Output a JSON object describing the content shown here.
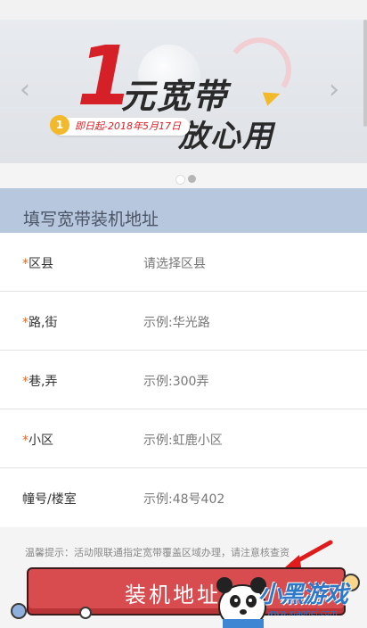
{
  "banner": {
    "big_number": "1",
    "title_line1": "元宽带",
    "title_line2": "放心用",
    "coin_text": "1",
    "date_text": "即日起-2018年5月17日",
    "prev_arrow": "‹",
    "next_arrow": "›"
  },
  "carousel": {
    "slide_count": 2,
    "active_index": 1
  },
  "section": {
    "title": "填写宽带装机地址"
  },
  "form": {
    "rows": [
      {
        "label": "区县",
        "required": "*",
        "value": "请选择区县"
      },
      {
        "label": "路,街",
        "required": "*",
        "value": "示例:华光路"
      },
      {
        "label": "巷,弄",
        "required": "*",
        "value": "示例:300弄"
      },
      {
        "label": "小区",
        "required": "*",
        "value": "示例:虹鹿小区"
      },
      {
        "label": "幢号/楼室",
        "required": "",
        "value": "示例:48号402"
      }
    ]
  },
  "tip": {
    "text": "温馨提示：活动限联通指定宽带覆盖区域办理，请注意核查资"
  },
  "submit": {
    "label": "装机地址"
  },
  "watermark": {
    "text": "小黑游戏",
    "url": "www.xiaohei.com"
  },
  "colors": {
    "accent_red": "#d84b4f",
    "section_blue": "#b7c7dd",
    "required_orange": "#e26a2b",
    "brand_red": "#d52027"
  }
}
